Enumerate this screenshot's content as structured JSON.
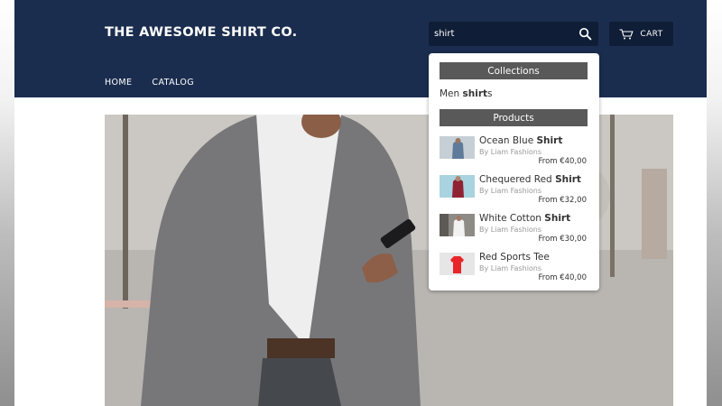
{
  "header": {
    "logo": "THE AWESOME SHIRT CO.",
    "nav": [
      "HOME",
      "CATALOG"
    ],
    "search": {
      "value": "shirt"
    },
    "cart_label": "CART"
  },
  "search_dropdown": {
    "collections_heading": "Collections",
    "collections": [
      {
        "before": "Men ",
        "match": "shirt",
        "after": "s"
      }
    ],
    "products_heading": "Products",
    "products": [
      {
        "name_before": "Ocean Blue ",
        "name_match": "Shirt",
        "vendor": "By Liam Fashions",
        "price": "From €40,00",
        "thumb": "ocean-blue-shirt"
      },
      {
        "name_before": "Chequered Red ",
        "name_match": "Shirt",
        "vendor": "By Liam Fashions",
        "price": "From €32,00",
        "thumb": "chequered-red-shirt"
      },
      {
        "name_before": "White Cotton ",
        "name_match": "Shirt",
        "vendor": "By Liam Fashions",
        "price": "From €30,00",
        "thumb": "white-cotton-shirt"
      },
      {
        "name_before": "Red Sports Tee",
        "name_match": "",
        "vendor": "By Liam Fashions",
        "price": "From €40,00",
        "thumb": "red-sports-tee"
      }
    ]
  },
  "colors": {
    "header_bg": "#1b2d4f",
    "search_bg": "#0f1d36",
    "section_bg": "#595959"
  }
}
